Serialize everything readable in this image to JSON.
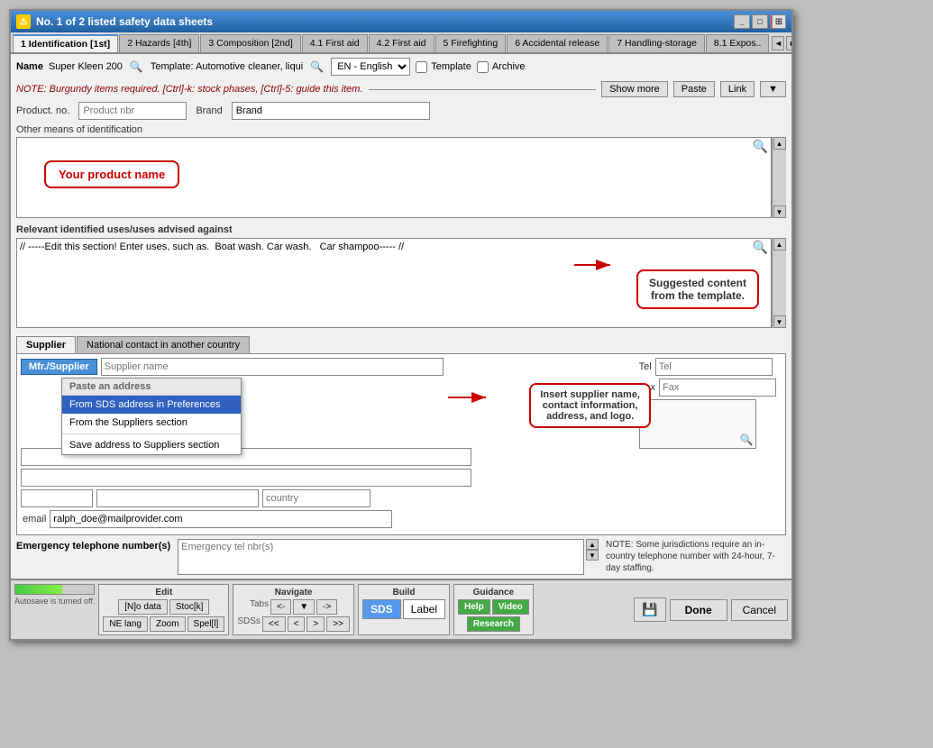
{
  "window": {
    "title": "No. 1 of 2 listed safety data sheets",
    "icon": "⚠"
  },
  "tabs": [
    {
      "id": "tab1",
      "label": "1 Identification [1st]",
      "active": true
    },
    {
      "id": "tab2",
      "label": "2 Hazards [4th]",
      "active": false
    },
    {
      "id": "tab3",
      "label": "3 Composition [2nd]",
      "active": false
    },
    {
      "id": "tab4",
      "label": "4.1 First aid",
      "active": false
    },
    {
      "id": "tab5",
      "label": "4.2 First aid",
      "active": false
    },
    {
      "id": "tab6",
      "label": "5 Firefighting",
      "active": false
    },
    {
      "id": "tab7",
      "label": "6 Accidental release",
      "active": false
    },
    {
      "id": "tab8",
      "label": "7 Handling-storage",
      "active": false
    },
    {
      "id": "tab9",
      "label": "8.1 Expos..",
      "active": false
    }
  ],
  "name_row": {
    "name_label": "Name",
    "name_value": "Super Kleen 200",
    "template_label": "Template: Automotive cleaner, liqui",
    "lang_value": "EN - English",
    "template_checkbox_label": "Template",
    "archive_checkbox_label": "Archive"
  },
  "note": {
    "text": "NOTE: Burgundy items required. [Ctrl]-k: stock phases, [Ctrl]-5: guide this item.",
    "show_more": "Show more",
    "paste": "Paste",
    "link": "Link"
  },
  "product_row": {
    "product_no_label": "Product. no.",
    "product_no_placeholder": "Product nbr",
    "brand_label": "Brand",
    "brand_placeholder": "Brand",
    "brand_value": "Brand"
  },
  "other_means": {
    "label": "Other means of identification",
    "callout": "Your product name"
  },
  "relevant": {
    "label": "Relevant identified uses/uses advised against",
    "content": "// -----Edit this section! Enter uses, such as.  Boat wash. Car wash.   Car shampoo----- //"
  },
  "suggested_callout": {
    "text": "Suggested content\nfrom the template."
  },
  "supplier_tabs": [
    {
      "label": "Supplier",
      "active": true
    },
    {
      "label": "National contact in another country",
      "active": false
    }
  ],
  "supplier": {
    "mfr_tab": "Mfr./Supplier",
    "tel_label": "Tel",
    "tel_placeholder": "Tel",
    "fax_label": "Fax",
    "fax_placeholder": "Fax",
    "email_label": "email",
    "email_value": "ralph_doe@mailprovider.com"
  },
  "context_menu": {
    "header": "Paste an address",
    "item1": "From SDS address in Preferences",
    "item2": "From the Suppliers section",
    "item3": "Save address to Suppliers section"
  },
  "insert_callout": {
    "text": "Insert supplier name,\ncontact information,\naddress, and logo."
  },
  "emergency": {
    "label": "Emergency telephone number(s)",
    "placeholder": "Emergency tel nbr(s)",
    "note": "NOTE: Some jurisdictions require an in-country telephone number with 24-hour, 7-day staffing."
  },
  "toolbar": {
    "edit_label": "Edit",
    "ndata_label": "[N]o data",
    "stoc_label": "Stoc[k]",
    "ne_lang_label": "NE lang",
    "zoom_label": "Zoom",
    "spell_label": "Spel[l]",
    "navigate_label": "Navigate",
    "tabs_label": "Tabs",
    "tabs_left": "<-",
    "tabs_right": "->",
    "sdss_label": "SDSs",
    "sdds_prev": "<<",
    "sdds_prev2": "<",
    "sdds_next": ">",
    "sdds_next2": ">>",
    "build_label": "Build",
    "sds_btn": "SDS",
    "label_btn": "Label",
    "guidance_label": "Guidance",
    "help_btn": "Help",
    "video_btn": "Video",
    "research_btn": "Research",
    "autosave_text": "Autosave is turned off.",
    "progress_pct": 60,
    "done_btn": "Done",
    "cancel_btn": "Cancel"
  }
}
